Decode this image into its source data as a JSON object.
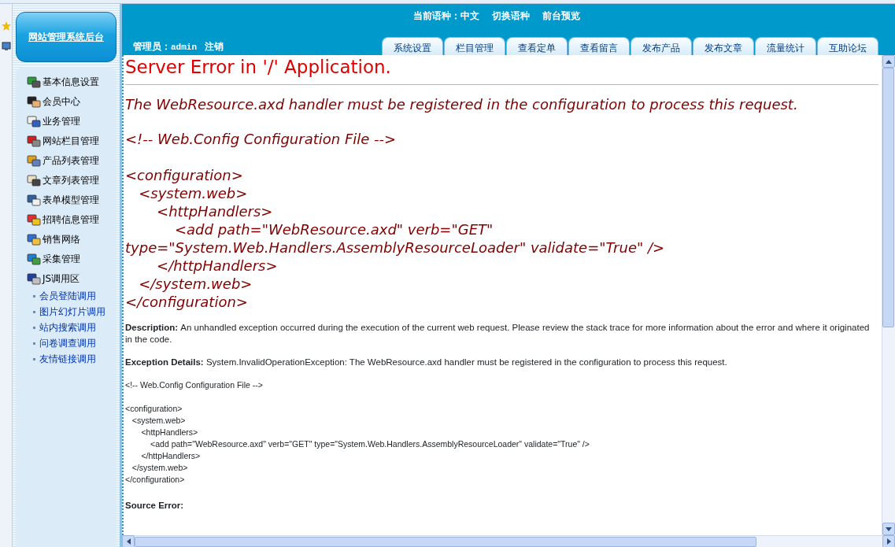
{
  "header": {
    "language": "当前语种：中文",
    "switch_language": "切换语种",
    "preview": "前台预览",
    "admin_label": "管理员：",
    "admin_name": "admin",
    "logout": "注销",
    "tabs": [
      {
        "label": "系统设置",
        "selected": false
      },
      {
        "label": "栏目管理",
        "selected": false
      },
      {
        "label": "查看定单",
        "selected": false
      },
      {
        "label": "查看留言",
        "selected": false
      },
      {
        "label": "发布产品",
        "selected": false
      },
      {
        "label": "发布文章",
        "selected": false
      },
      {
        "label": "流量统计",
        "selected": false
      },
      {
        "label": "互助论坛",
        "selected": false
      }
    ]
  },
  "sidebar": {
    "logo": "网站管理系统后台",
    "items": [
      {
        "label": "基本信息设置"
      },
      {
        "label": "会员中心"
      },
      {
        "label": "业务管理"
      },
      {
        "label": "网站栏目管理"
      },
      {
        "label": "产品列表管理"
      },
      {
        "label": "文章列表管理"
      },
      {
        "label": "表单模型管理"
      },
      {
        "label": "招聘信息管理"
      },
      {
        "label": "销售网络"
      },
      {
        "label": "采集管理"
      },
      {
        "label": "JS调用区"
      }
    ],
    "sub_items": [
      "会员登陆调用",
      "图片幻灯片调用",
      "站内搜索调用",
      "问卷调查调用",
      "友情链接调用"
    ]
  },
  "error": {
    "title": "Server Error in '/' Application.",
    "message": "The WebResource.axd handler must be registered in the configuration to process this request.",
    "config_comment": "<!-- Web.Config Configuration File -->",
    "config_lines": [
      "<configuration>",
      "   <system.web>",
      "       <httpHandlers>",
      "           <add path=\"WebResource.axd\" verb=\"GET\" type=\"System.Web.Handlers.AssemblyResourceLoader\" validate=\"True\" />",
      "       </httpHandlers>",
      "   </system.web>",
      "</configuration>"
    ],
    "description_label": "Description:",
    "description": "An unhandled exception occurred during the execution of the current web request. Please review the stack trace for more information about the error and where it originated in the code.",
    "exception_label": "Exception Details:",
    "exception": "System.InvalidOperationException: The WebResource.axd handler must be registered in the configuration to process this request.",
    "small_comment": "<!-- Web.Config Configuration File -->",
    "small_lines": [
      "<configuration>",
      "   <system.web>",
      "       <httpHandlers>",
      "           <add path=\"WebResource.axd\" verb=\"GET\" type=\"System.Web.Handlers.AssemblyResourceLoader\" validate=\"True\" />",
      "       </httpHandlers>",
      "   </system.web>",
      "</configuration>"
    ],
    "source_error_label": "Source Error:"
  }
}
